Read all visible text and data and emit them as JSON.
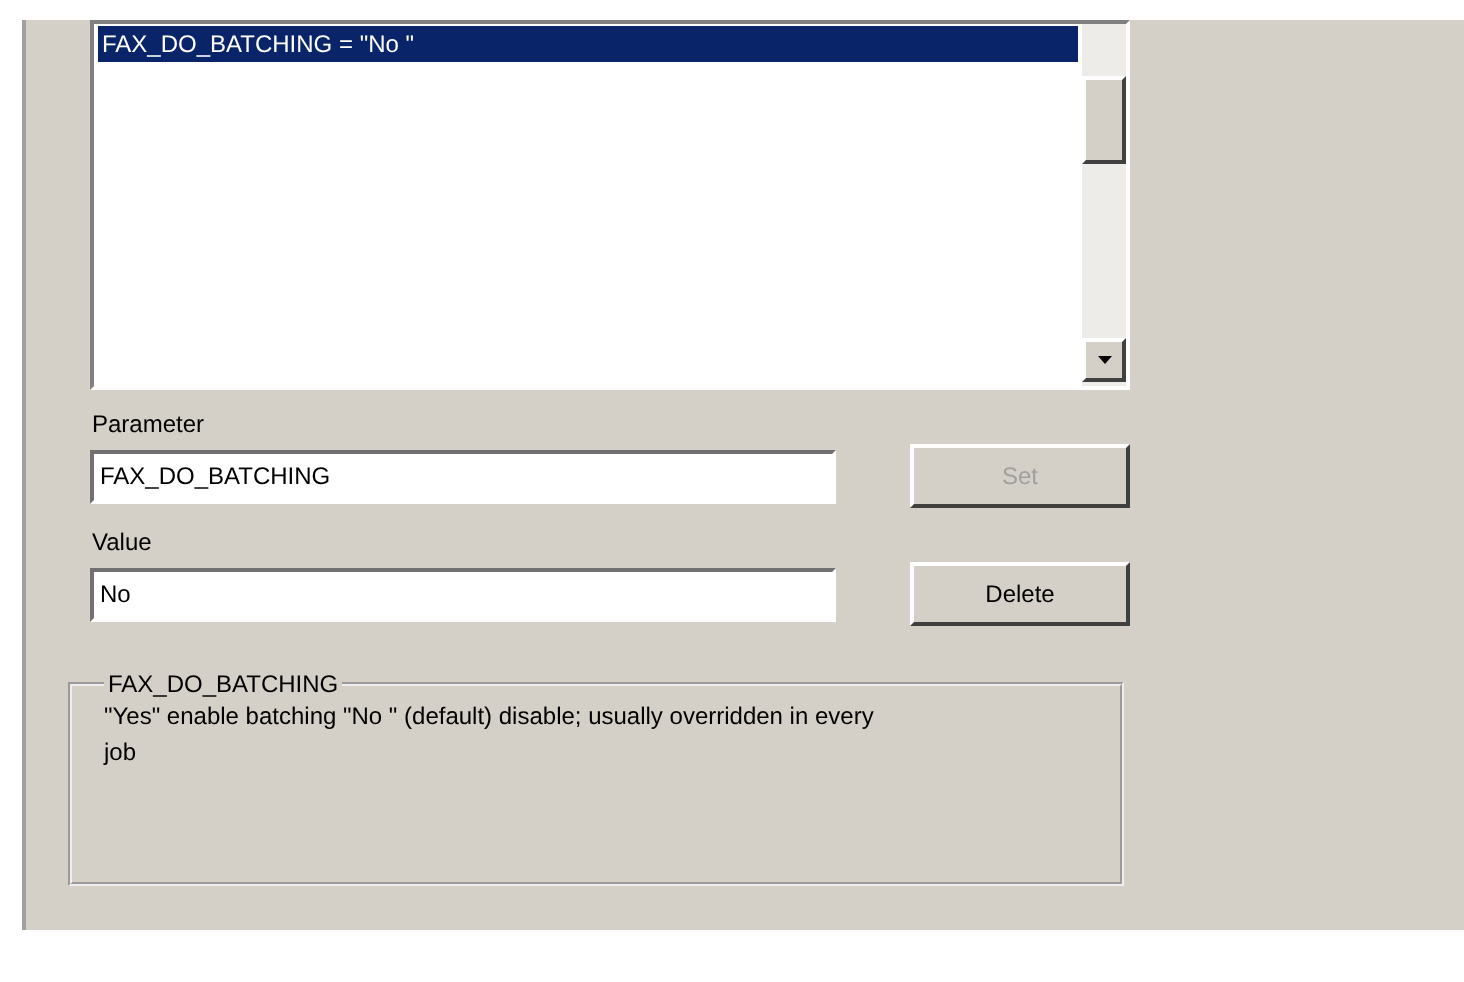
{
  "list": {
    "items": [
      {
        "text": "FAX_DO_BATCHING = \"No \"",
        "selected": true
      }
    ]
  },
  "parameter": {
    "label": "Parameter",
    "value": "FAX_DO_BATCHING"
  },
  "value": {
    "label": "Value",
    "value": "No"
  },
  "buttons": [
    {
      "label": "Set",
      "disabled": true
    },
    {
      "label": "Delete",
      "disabled": false
    }
  ],
  "description": {
    "title": "FAX_DO_BATCHING",
    "text": "\"Yes\" enable batching \"No \" (default) disable; usually overridden in every job"
  }
}
